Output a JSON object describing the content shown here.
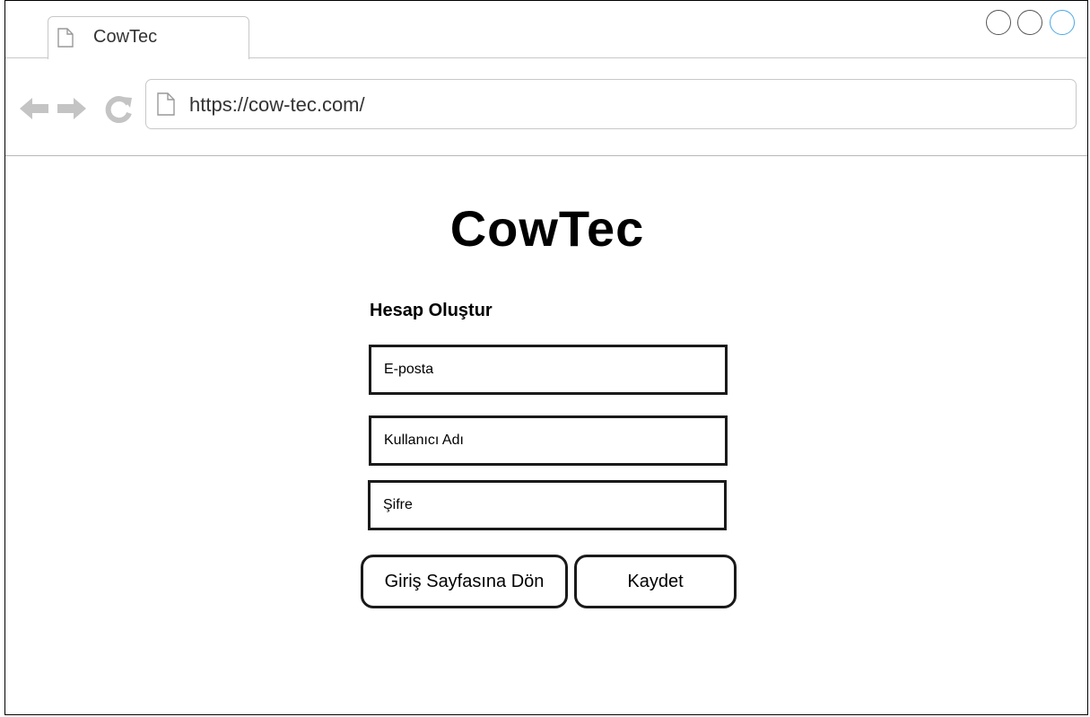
{
  "browser": {
    "tab": {
      "title": "CowTec",
      "icon": "page-icon"
    },
    "controls": [
      "circle-icon",
      "circle-icon",
      "circle-icon"
    ],
    "nav": {
      "back_icon": "arrow-left-icon",
      "forward_icon": "arrow-right-icon",
      "reload_icon": "reload-icon"
    },
    "url": "https://cow-tec.com/"
  },
  "page": {
    "brand": "CowTec",
    "form": {
      "title": "Hesap Oluştur",
      "email_placeholder": "E-posta",
      "username_placeholder": "Kullanıcı Adı",
      "password_placeholder": "Şifre",
      "back_button": "Giriş Sayfasına Dön",
      "save_button": "Kaydet"
    }
  },
  "colors": {
    "accent_control": "#4aa8e8",
    "border": "#1a1a1a",
    "chrome_border": "#c8c8c8"
  }
}
